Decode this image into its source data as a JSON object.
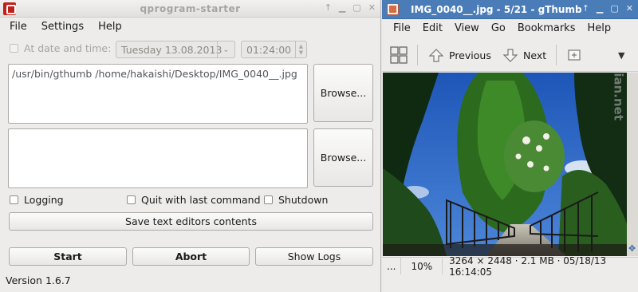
{
  "win1": {
    "title": "qprogram-starter",
    "menu": {
      "file": "File",
      "settings": "Settings",
      "help": "Help"
    },
    "at_date_label": "At date and time:",
    "date_value": "Tuesday 13.08.2013",
    "time_value": "01:24:00",
    "command1": "/usr/bin/gthumb /home/hakaishi/Desktop/IMG_0040__.jpg",
    "command2": "",
    "browse1": "Browse...",
    "browse2": "Browse...",
    "logging": "Logging",
    "quit_last": "Quit with last command",
    "shutdown": "Shutdown",
    "save_text": "Save text editors contents",
    "start": "Start",
    "abort": "Abort",
    "show_logs": "Show Logs",
    "version": "Version 1.6.7"
  },
  "win2": {
    "title": "IMG_0040__.jpg - 5/21 - gThumb",
    "menu": {
      "file": "File",
      "edit": "Edit",
      "view": "View",
      "go": "Go",
      "bookmarks": "Bookmarks",
      "help": "Help"
    },
    "previous": "Previous",
    "next": "Next",
    "status_more": "...",
    "zoom": "10%",
    "info": "3264 × 2448 · 2.1 MB · 05/18/13 16:14:05",
    "watermark": "screenshots.debian.net"
  },
  "colors": {
    "gthumb_titlebar": "#4a7cb8",
    "qps_icon": "#c0201a"
  }
}
